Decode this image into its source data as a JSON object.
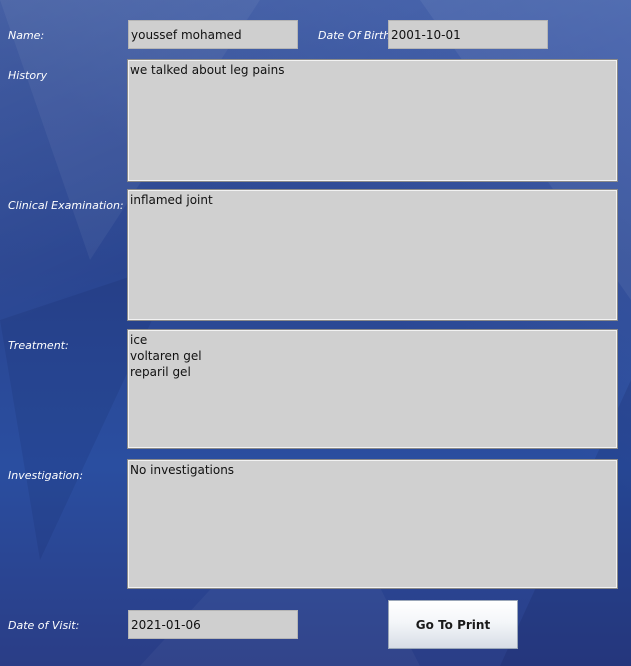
{
  "labels": {
    "name": "Name:",
    "dob": "Date Of Birth",
    "history": "History",
    "clinical": "Clinical Examination:",
    "treatment": "Treatment:",
    "investigation": "Investigation:",
    "visit": "Date of Visit:"
  },
  "values": {
    "name": "youssef mohamed",
    "dob": "2001-10-01",
    "history": "we talked about leg pains",
    "clinical": "inflamed joint",
    "treatment": "ice\nvoltaren gel\nreparil gel",
    "investigation": "No investigations",
    "visit": "2021-01-06"
  },
  "buttons": {
    "print": "Go To Print"
  }
}
